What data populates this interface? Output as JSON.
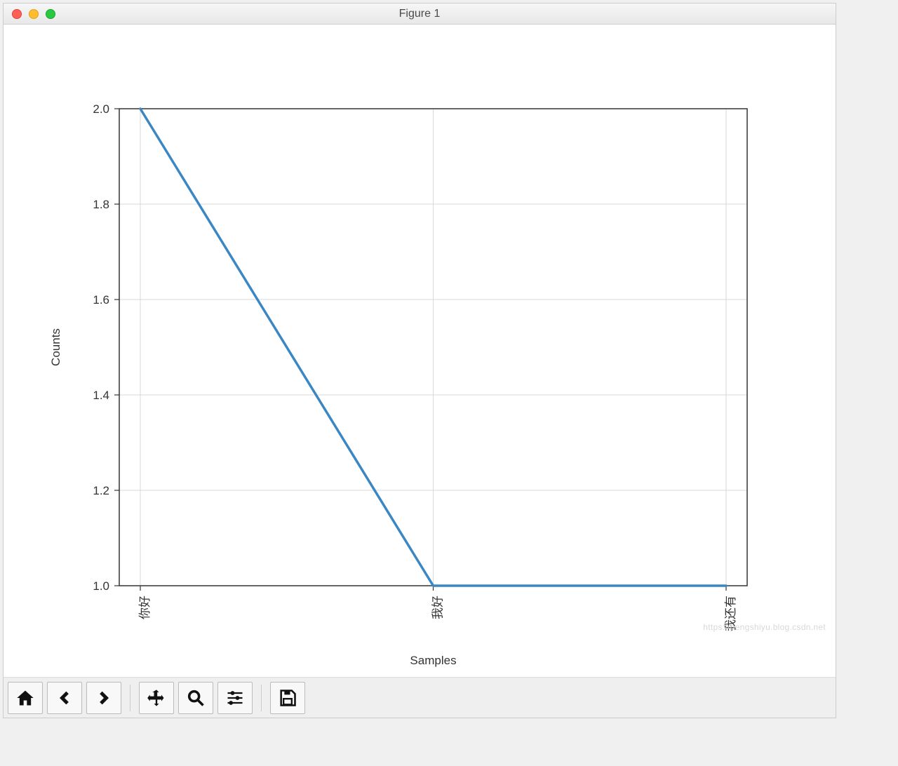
{
  "window": {
    "title": "Figure 1"
  },
  "chart_data": {
    "type": "line",
    "categories": [
      "你好",
      "我好",
      "我还有"
    ],
    "values": [
      2.0,
      1.0,
      1.0
    ],
    "xlabel": "Samples",
    "ylabel": "Counts",
    "ylim": [
      1.0,
      2.0
    ],
    "yticks": [
      1.0,
      1.2,
      1.4,
      1.6,
      1.8,
      2.0
    ],
    "ytick_labels": [
      "1.0",
      "1.2",
      "1.4",
      "1.6",
      "1.8",
      "2.0"
    ],
    "line_color": "#3a87c4",
    "grid": true
  },
  "toolbar": {
    "home": "Home",
    "back": "Back",
    "forward": "Forward",
    "pan": "Pan",
    "zoom": "Zoom",
    "configure": "Configure subplots",
    "save": "Save"
  },
  "watermark": "https://pengshiyu.blog.csdn.net"
}
